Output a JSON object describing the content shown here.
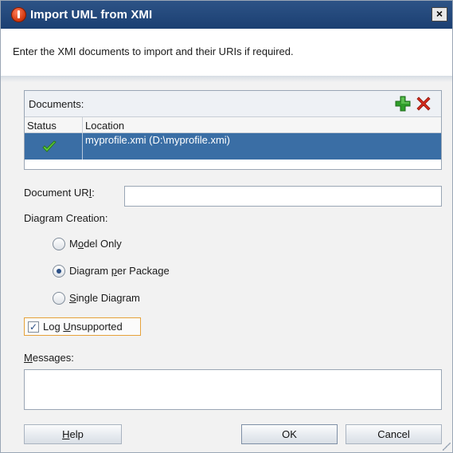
{
  "window": {
    "title": "Import UML from XMI",
    "close_label": "×"
  },
  "instructions": "Enter the XMI documents to import and their URIs if required.",
  "documents": {
    "label": "Documents:",
    "add_icon": "plus-icon",
    "remove_icon": "x-icon",
    "columns": [
      "Status",
      "Location"
    ],
    "rows": [
      {
        "status": "check-icon",
        "location": "myprofile.xmi (D:\\myprofile.xmi)",
        "selected": true
      }
    ]
  },
  "document_uri": {
    "label": "Document URI:",
    "value": ""
  },
  "diagram_creation": {
    "label": "Diagram Creation:",
    "options": [
      {
        "label": "Model Only",
        "selected": false
      },
      {
        "label": "Diagram per Package",
        "selected": true
      },
      {
        "label": "Single Diagram",
        "selected": false
      }
    ]
  },
  "log_unsupported": {
    "label": "Log Unsupported",
    "checked": true
  },
  "messages": {
    "label": "Messages:",
    "value": ""
  },
  "buttons": {
    "help": "Help",
    "ok": "OK",
    "cancel": "Cancel"
  },
  "colors": {
    "titlebar": "#1b3f72",
    "selection": "#3a6ea5",
    "focus_border": "#e6a23a",
    "add_green": "#2f9e2a",
    "remove_red": "#d42b1c"
  }
}
